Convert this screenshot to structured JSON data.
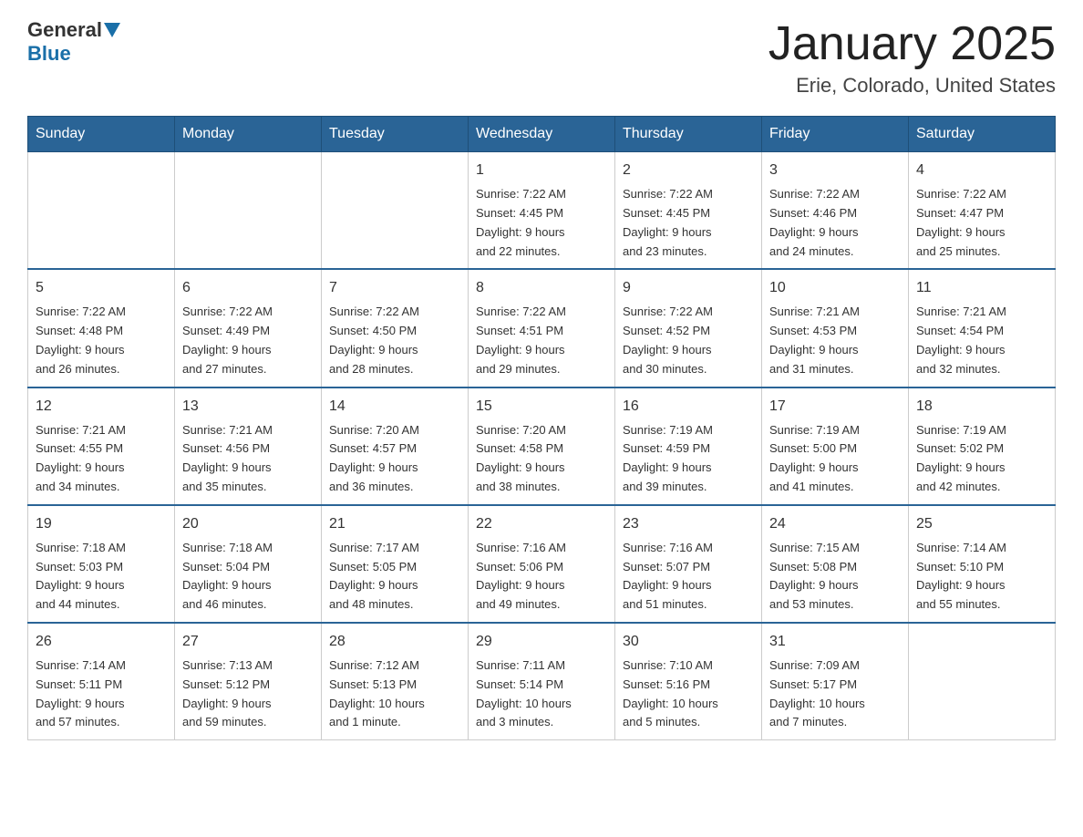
{
  "header": {
    "logo_general": "General",
    "logo_blue": "Blue",
    "month_title": "January 2025",
    "location": "Erie, Colorado, United States"
  },
  "days_of_week": [
    "Sunday",
    "Monday",
    "Tuesday",
    "Wednesday",
    "Thursday",
    "Friday",
    "Saturday"
  ],
  "weeks": [
    [
      {
        "day": "",
        "info": ""
      },
      {
        "day": "",
        "info": ""
      },
      {
        "day": "",
        "info": ""
      },
      {
        "day": "1",
        "info": "Sunrise: 7:22 AM\nSunset: 4:45 PM\nDaylight: 9 hours\nand 22 minutes."
      },
      {
        "day": "2",
        "info": "Sunrise: 7:22 AM\nSunset: 4:45 PM\nDaylight: 9 hours\nand 23 minutes."
      },
      {
        "day": "3",
        "info": "Sunrise: 7:22 AM\nSunset: 4:46 PM\nDaylight: 9 hours\nand 24 minutes."
      },
      {
        "day": "4",
        "info": "Sunrise: 7:22 AM\nSunset: 4:47 PM\nDaylight: 9 hours\nand 25 minutes."
      }
    ],
    [
      {
        "day": "5",
        "info": "Sunrise: 7:22 AM\nSunset: 4:48 PM\nDaylight: 9 hours\nand 26 minutes."
      },
      {
        "day": "6",
        "info": "Sunrise: 7:22 AM\nSunset: 4:49 PM\nDaylight: 9 hours\nand 27 minutes."
      },
      {
        "day": "7",
        "info": "Sunrise: 7:22 AM\nSunset: 4:50 PM\nDaylight: 9 hours\nand 28 minutes."
      },
      {
        "day": "8",
        "info": "Sunrise: 7:22 AM\nSunset: 4:51 PM\nDaylight: 9 hours\nand 29 minutes."
      },
      {
        "day": "9",
        "info": "Sunrise: 7:22 AM\nSunset: 4:52 PM\nDaylight: 9 hours\nand 30 minutes."
      },
      {
        "day": "10",
        "info": "Sunrise: 7:21 AM\nSunset: 4:53 PM\nDaylight: 9 hours\nand 31 minutes."
      },
      {
        "day": "11",
        "info": "Sunrise: 7:21 AM\nSunset: 4:54 PM\nDaylight: 9 hours\nand 32 minutes."
      }
    ],
    [
      {
        "day": "12",
        "info": "Sunrise: 7:21 AM\nSunset: 4:55 PM\nDaylight: 9 hours\nand 34 minutes."
      },
      {
        "day": "13",
        "info": "Sunrise: 7:21 AM\nSunset: 4:56 PM\nDaylight: 9 hours\nand 35 minutes."
      },
      {
        "day": "14",
        "info": "Sunrise: 7:20 AM\nSunset: 4:57 PM\nDaylight: 9 hours\nand 36 minutes."
      },
      {
        "day": "15",
        "info": "Sunrise: 7:20 AM\nSunset: 4:58 PM\nDaylight: 9 hours\nand 38 minutes."
      },
      {
        "day": "16",
        "info": "Sunrise: 7:19 AM\nSunset: 4:59 PM\nDaylight: 9 hours\nand 39 minutes."
      },
      {
        "day": "17",
        "info": "Sunrise: 7:19 AM\nSunset: 5:00 PM\nDaylight: 9 hours\nand 41 minutes."
      },
      {
        "day": "18",
        "info": "Sunrise: 7:19 AM\nSunset: 5:02 PM\nDaylight: 9 hours\nand 42 minutes."
      }
    ],
    [
      {
        "day": "19",
        "info": "Sunrise: 7:18 AM\nSunset: 5:03 PM\nDaylight: 9 hours\nand 44 minutes."
      },
      {
        "day": "20",
        "info": "Sunrise: 7:18 AM\nSunset: 5:04 PM\nDaylight: 9 hours\nand 46 minutes."
      },
      {
        "day": "21",
        "info": "Sunrise: 7:17 AM\nSunset: 5:05 PM\nDaylight: 9 hours\nand 48 minutes."
      },
      {
        "day": "22",
        "info": "Sunrise: 7:16 AM\nSunset: 5:06 PM\nDaylight: 9 hours\nand 49 minutes."
      },
      {
        "day": "23",
        "info": "Sunrise: 7:16 AM\nSunset: 5:07 PM\nDaylight: 9 hours\nand 51 minutes."
      },
      {
        "day": "24",
        "info": "Sunrise: 7:15 AM\nSunset: 5:08 PM\nDaylight: 9 hours\nand 53 minutes."
      },
      {
        "day": "25",
        "info": "Sunrise: 7:14 AM\nSunset: 5:10 PM\nDaylight: 9 hours\nand 55 minutes."
      }
    ],
    [
      {
        "day": "26",
        "info": "Sunrise: 7:14 AM\nSunset: 5:11 PM\nDaylight: 9 hours\nand 57 minutes."
      },
      {
        "day": "27",
        "info": "Sunrise: 7:13 AM\nSunset: 5:12 PM\nDaylight: 9 hours\nand 59 minutes."
      },
      {
        "day": "28",
        "info": "Sunrise: 7:12 AM\nSunset: 5:13 PM\nDaylight: 10 hours\nand 1 minute."
      },
      {
        "day": "29",
        "info": "Sunrise: 7:11 AM\nSunset: 5:14 PM\nDaylight: 10 hours\nand 3 minutes."
      },
      {
        "day": "30",
        "info": "Sunrise: 7:10 AM\nSunset: 5:16 PM\nDaylight: 10 hours\nand 5 minutes."
      },
      {
        "day": "31",
        "info": "Sunrise: 7:09 AM\nSunset: 5:17 PM\nDaylight: 10 hours\nand 7 minutes."
      },
      {
        "day": "",
        "info": ""
      }
    ]
  ]
}
